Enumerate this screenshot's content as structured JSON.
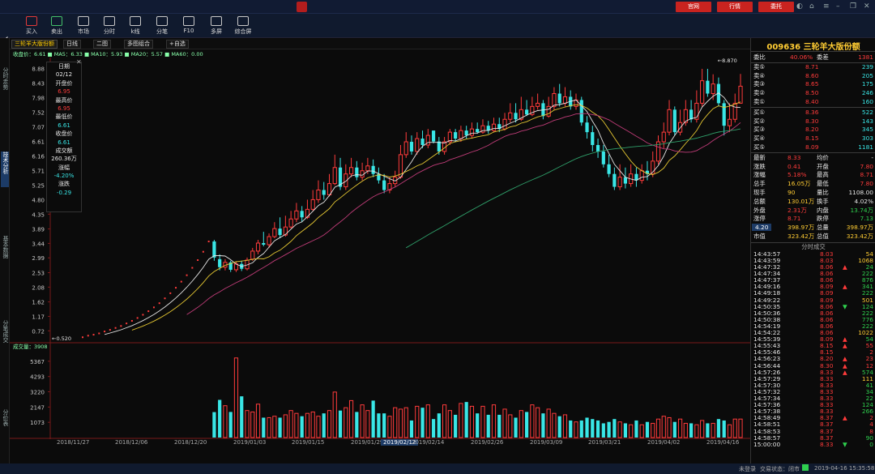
{
  "app": {
    "title": ""
  },
  "header_buttons": [
    "官网",
    "行情",
    "委托"
  ],
  "toolbar": [
    {
      "label": "买入",
      "icon": "buy-icon",
      "color": "red"
    },
    {
      "label": "卖出",
      "icon": "sell-icon",
      "color": "grn"
    },
    {
      "label": "市场",
      "icon": "market-icon",
      "color": ""
    },
    {
      "label": "分时",
      "icon": "timeshare-icon",
      "color": ""
    },
    {
      "label": "k线",
      "icon": "kline-icon",
      "color": ""
    },
    {
      "label": "分笔",
      "icon": "ticks-icon",
      "color": ""
    },
    {
      "label": "F10",
      "icon": "f10-icon",
      "color": ""
    },
    {
      "label": "多屏",
      "icon": "multiscreen-icon",
      "color": ""
    },
    {
      "label": "综合屏",
      "icon": "dashboard-icon",
      "color": ""
    }
  ],
  "left_tabs": [
    "分时走势",
    "技术分析",
    "基本数据",
    "分笔成交",
    "分价表"
  ],
  "chart_tabs": [
    "三轮羊大版份额",
    "日线",
    "二图",
    "多图组合",
    "+自选"
  ],
  "ma_legend": "收盘价：6.61  ■ MA5：6.33  ■ MA10：5.93  ■ MA20：5.57  ■ MA60：0.00",
  "vol_legend": "成交量：3908",
  "info": {
    "date_label": "日期",
    "date": "02/12",
    "open_label": "开盘价",
    "open": "6.95",
    "high_label": "最高价",
    "high": "6.95",
    "low_label": "最低价",
    "low": "6.61",
    "close_label": "收盘价",
    "close": "6.61",
    "amount_label": "成交额",
    "amount": "260.36万",
    "pct_label": "涨幅",
    "pct": "-4.20%",
    "chg_label": "涨跌",
    "chg": "-0.29"
  },
  "annotations": {
    "high": "←8.870",
    "low": "←0.520"
  },
  "right": {
    "code": "009636",
    "name": "三轮羊大版份额",
    "wei": {
      "l1": "委比",
      "v1": "40.06%",
      "l2": "委差",
      "v2": "1381"
    },
    "sells": [
      {
        "label": "卖⑤",
        "price": "8.71",
        "vol": "239"
      },
      {
        "label": "卖④",
        "price": "8.60",
        "vol": "205"
      },
      {
        "label": "卖③",
        "price": "8.65",
        "vol": "175"
      },
      {
        "label": "卖②",
        "price": "8.50",
        "vol": "246"
      },
      {
        "label": "卖①",
        "price": "8.40",
        "vol": "160"
      }
    ],
    "buys": [
      {
        "label": "买①",
        "price": "8.36",
        "vol": "522"
      },
      {
        "label": "买②",
        "price": "8.30",
        "vol": "143"
      },
      {
        "label": "买③",
        "price": "8.20",
        "vol": "345"
      },
      {
        "label": "买④",
        "price": "8.15",
        "vol": "303"
      },
      {
        "label": "买⑤",
        "price": "8.09",
        "vol": "1181"
      }
    ],
    "stats": [
      {
        "l1": "最新",
        "v1": "8.33",
        "c1": "red",
        "l2": "均价",
        "v2": "-",
        "c2": "wht"
      },
      {
        "l1": "涨跌",
        "v1": "0.41",
        "c1": "red",
        "l2": "开盘",
        "v2": "7.80",
        "c2": "red"
      },
      {
        "l1": "涨幅",
        "v1": "5.18%",
        "c1": "red",
        "l2": "最高",
        "v2": "8.71",
        "c2": "red"
      },
      {
        "l1": "总手",
        "v1": "16.05万",
        "c1": "yel",
        "l2": "最低",
        "v2": "7.80",
        "c2": "red"
      },
      {
        "l1": "现手",
        "v1": "90",
        "c1": "yel",
        "l2": "量比",
        "v2": "1108.00",
        "c2": "wht"
      },
      {
        "l1": "总额",
        "v1": "130.01万",
        "c1": "yel",
        "l2": "换手",
        "v2": "4.02%",
        "c2": "wht"
      },
      {
        "l1": "外盘",
        "v1": "2.31万",
        "c1": "red",
        "l2": "内盘",
        "v2": "13.74万",
        "c2": "grn"
      },
      {
        "l1": "涨停",
        "v1": "8.71",
        "c1": "red",
        "l2": "跌停",
        "v2": "7.13",
        "c2": "grn"
      },
      {
        "l1": "4.20",
        "v1": "398.97万",
        "c1": "yel",
        "l2": "总量",
        "v2": "398.97万",
        "c2": "yel"
      },
      {
        "l1": "市值",
        "v1": "323.42万",
        "c1": "yel",
        "l2": "总值",
        "v2": "323.42万",
        "c2": "yel"
      }
    ],
    "ticks_title": "分时成交",
    "ticks": [
      [
        "14:43:57",
        "8.03",
        "",
        "54",
        "yel"
      ],
      [
        "14:43:59",
        "8.03",
        "",
        "1068",
        "yel"
      ],
      [
        "14:47:32",
        "8.06",
        "▲",
        "24",
        "grn"
      ],
      [
        "14:47:34",
        "8.06",
        "",
        "222",
        "grn"
      ],
      [
        "14:47:37",
        "8.06",
        "",
        "876",
        "grn"
      ],
      [
        "14:49:16",
        "8.09",
        "▲",
        "341",
        "grn"
      ],
      [
        "14:49:18",
        "8.09",
        "",
        "222",
        "grn"
      ],
      [
        "14:49:22",
        "8.09",
        "",
        "501",
        "yel"
      ],
      [
        "14:50:35",
        "8.06",
        "▼",
        "124",
        "grn"
      ],
      [
        "14:50:36",
        "8.06",
        "",
        "222",
        "grn"
      ],
      [
        "14:50:38",
        "8.06",
        "",
        "776",
        "grn"
      ],
      [
        "14:54:19",
        "8.06",
        "",
        "222",
        "grn"
      ],
      [
        "14:54:22",
        "8.06",
        "",
        "1022",
        "yel"
      ],
      [
        "14:55:39",
        "8.09",
        "▲",
        "54",
        "grn"
      ],
      [
        "14:55:43",
        "8.15",
        "▲",
        "55",
        "red"
      ],
      [
        "14:55:46",
        "8.15",
        "",
        "2",
        "red"
      ],
      [
        "14:56:23",
        "8.20",
        "▲",
        "23",
        "red"
      ],
      [
        "14:56:44",
        "8.30",
        "▲",
        "12",
        "red"
      ],
      [
        "14:57:26",
        "8.33",
        "▲",
        "574",
        "grn"
      ],
      [
        "14:57:29",
        "8.33",
        "",
        "111",
        "yel"
      ],
      [
        "14:57:30",
        "8.33",
        "",
        "41",
        "grn"
      ],
      [
        "14:57:32",
        "8.33",
        "",
        "34",
        "grn"
      ],
      [
        "14:57:34",
        "8.33",
        "",
        "22",
        "grn"
      ],
      [
        "14:57:36",
        "8.33",
        "",
        "124",
        "grn"
      ],
      [
        "14:57:38",
        "8.33",
        "",
        "266",
        "grn"
      ],
      [
        "14:58:49",
        "8.37",
        "▲",
        "2",
        "red"
      ],
      [
        "14:58:51",
        "8.37",
        "",
        "4",
        "red"
      ],
      [
        "14:58:53",
        "8.37",
        "",
        "8",
        "red"
      ],
      [
        "14:58:57",
        "8.37",
        "",
        "90",
        "grn"
      ],
      [
        "15:00:00",
        "8.33",
        "▼",
        "0",
        "grn"
      ]
    ]
  },
  "status": {
    "text1": "未登录",
    "text2": "交易状态：闭市",
    "time": "2019-04-16 15:35:58"
  },
  "chart_data": {
    "type": "candlestick",
    "price_ticks": [
      "8.88",
      "8.43",
      "7.98",
      "7.52",
      "7.07",
      "6.61",
      "6.16",
      "5.71",
      "5.25",
      "4.80",
      "4.35",
      "3.89",
      "3.44",
      "2.99",
      "2.53",
      "2.08",
      "1.62",
      "1.17",
      "0.72"
    ],
    "price_range": [
      0.4,
      9.02
    ],
    "volume_ticks": [
      "5367",
      "4293",
      "3220",
      "2147",
      "1073"
    ],
    "volume_range": [
      0,
      6100
    ],
    "x_labels": [
      "2018/11/27",
      "2018/12/06",
      "2018/12/20",
      "2019/01/03",
      "2019/01/15",
      "2019/01/29",
      "2019/02/12",
      "2019/02/14",
      "2019/02/26",
      "2019/03/09",
      "2019/03/21",
      "2019/04/02",
      "2019/04/16"
    ],
    "highlight_label": "2019/02/12",
    "up_color": "#ff3b3b",
    "down_color": "#39e6e6",
    "ma_colors": {
      "ma5": "#e6e6e6",
      "ma10": "#e6c832",
      "ma20": "#c03c78",
      "ma60": "#2fa06a"
    },
    "candles": [
      [
        0.52,
        0.52,
        0.5,
        0.52,
        0
      ],
      [
        0.56,
        0.57,
        0.54,
        0.57,
        0
      ],
      [
        0.58,
        0.6,
        0.56,
        0.6,
        0
      ],
      [
        0.61,
        0.64,
        0.6,
        0.64,
        0
      ],
      [
        0.67,
        0.7,
        0.65,
        0.7,
        0
      ],
      [
        0.71,
        0.75,
        0.7,
        0.75,
        0
      ],
      [
        0.77,
        0.81,
        0.76,
        0.81,
        0
      ],
      [
        0.82,
        0.87,
        0.81,
        0.87,
        0
      ],
      [
        0.89,
        0.95,
        0.88,
        0.95,
        0
      ],
      [
        0.96,
        1.03,
        0.95,
        1.03,
        0
      ],
      [
        1.05,
        1.12,
        1.03,
        1.12,
        0
      ],
      [
        1.14,
        1.22,
        1.13,
        1.22,
        0
      ],
      [
        1.24,
        1.33,
        1.23,
        1.33,
        0
      ],
      [
        1.35,
        1.45,
        1.34,
        1.45,
        0
      ],
      [
        1.47,
        1.58,
        1.46,
        1.58,
        0
      ],
      [
        1.6,
        1.73,
        1.59,
        1.73,
        0
      ],
      [
        1.75,
        1.89,
        1.74,
        1.89,
        0
      ],
      [
        1.91,
        2.06,
        1.9,
        2.06,
        0
      ],
      [
        2.08,
        2.25,
        2.06,
        2.25,
        0
      ],
      [
        2.27,
        2.45,
        2.25,
        2.45,
        0
      ],
      [
        2.48,
        2.68,
        2.46,
        2.68,
        0
      ],
      [
        2.7,
        2.92,
        2.68,
        2.92,
        0
      ],
      [
        2.95,
        3.18,
        2.9,
        3.18,
        0
      ],
      [
        3.2,
        3.5,
        3.15,
        3.5,
        0
      ],
      [
        3.5,
        3.0,
        2.9,
        3.55,
        1790
      ],
      [
        2.95,
        2.7,
        2.6,
        3.1,
        2650
      ],
      [
        2.7,
        2.85,
        2.6,
        2.95,
        2240
      ],
      [
        2.85,
        2.62,
        2.55,
        2.9,
        1800
      ],
      [
        2.62,
        2.8,
        2.55,
        2.88,
        5600
      ],
      [
        2.8,
        2.65,
        2.58,
        2.9,
        2900
      ],
      [
        2.65,
        2.92,
        2.6,
        3.0,
        1900
      ],
      [
        2.95,
        3.2,
        2.9,
        3.3,
        1800
      ],
      [
        3.2,
        3.45,
        3.1,
        3.55,
        2350
      ],
      [
        3.45,
        3.4,
        3.35,
        3.8,
        1400
      ],
      [
        3.4,
        3.65,
        3.3,
        3.75,
        1400
      ],
      [
        3.65,
        3.9,
        3.6,
        4.1,
        1500
      ],
      [
        3.9,
        3.7,
        3.6,
        4.25,
        1400
      ],
      [
        3.7,
        3.95,
        3.65,
        4.3,
        1600
      ],
      [
        3.95,
        4.2,
        3.9,
        4.45,
        1900
      ],
      [
        4.2,
        4.45,
        4.1,
        4.7,
        1700
      ],
      [
        4.45,
        4.25,
        4.1,
        4.6,
        1500
      ],
      [
        4.25,
        4.5,
        4.2,
        4.8,
        1700
      ],
      [
        4.5,
        4.8,
        4.45,
        5.1,
        1800
      ],
      [
        4.8,
        5.1,
        4.7,
        5.4,
        1500
      ],
      [
        5.1,
        4.95,
        4.8,
        5.35,
        1700
      ],
      [
        4.95,
        5.3,
        4.9,
        5.6,
        1900
      ],
      [
        5.3,
        5.8,
        5.25,
        6.2,
        3200
      ],
      [
        5.8,
        5.2,
        5.1,
        6.1,
        1900
      ],
      [
        5.2,
        5.6,
        5.1,
        5.9,
        2100
      ],
      [
        5.6,
        5.8,
        5.5,
        6.1,
        2600
      ],
      [
        5.8,
        5.5,
        5.4,
        6.0,
        1800
      ],
      [
        5.5,
        5.7,
        5.4,
        5.95,
        2300
      ],
      [
        5.7,
        5.85,
        5.6,
        6.1,
        1900
      ],
      [
        5.85,
        5.6,
        5.5,
        6.05,
        2600
      ],
      [
        5.6,
        5.4,
        5.3,
        5.8,
        1700
      ],
      [
        5.4,
        5.1,
        5.0,
        5.6,
        1700
      ],
      [
        5.1,
        5.3,
        5.0,
        5.5,
        1500
      ],
      [
        5.3,
        5.5,
        5.2,
        5.7,
        2100
      ],
      [
        5.5,
        6.2,
        5.45,
        6.5,
        2000
      ],
      [
        6.2,
        6.6,
        6.1,
        6.9,
        2100
      ],
      [
        6.6,
        6.3,
        6.2,
        6.8,
        1200
      ],
      [
        6.3,
        6.7,
        6.2,
        6.9,
        2200
      ],
      [
        6.7,
        6.5,
        6.4,
        6.95,
        2100
      ],
      [
        6.5,
        6.8,
        6.4,
        7.0,
        2300
      ],
      [
        6.95,
        6.61,
        6.55,
        6.95,
        1300
      ],
      [
        6.61,
        6.3,
        6.2,
        6.75,
        1700
      ],
      [
        6.3,
        6.6,
        6.2,
        6.75,
        2300
      ],
      [
        6.6,
        6.9,
        6.5,
        7.0,
        1900
      ],
      [
        6.9,
        6.7,
        6.6,
        7.0,
        1600
      ],
      [
        6.7,
        6.95,
        6.6,
        7.1,
        2400
      ],
      [
        6.95,
        6.8,
        6.7,
        7.1,
        2500
      ],
      [
        6.8,
        7.0,
        6.7,
        7.2,
        2200
      ],
      [
        7.0,
        6.9,
        6.85,
        7.2,
        1700
      ],
      [
        6.9,
        7.1,
        6.85,
        7.3,
        2200
      ],
      [
        7.1,
        6.95,
        6.85,
        7.25,
        1600
      ],
      [
        6.95,
        7.15,
        6.9,
        7.35,
        2300
      ],
      [
        7.15,
        7.0,
        6.9,
        7.35,
        1600
      ],
      [
        7.0,
        7.3,
        6.95,
        7.5,
        2000
      ],
      [
        7.3,
        7.5,
        7.2,
        7.8,
        1600
      ],
      [
        7.5,
        7.3,
        7.2,
        7.8,
        1400
      ],
      [
        7.3,
        7.6,
        7.25,
        8.0,
        1900
      ],
      [
        7.6,
        7.45,
        7.4,
        7.9,
        1800
      ],
      [
        7.45,
        7.7,
        7.4,
        8.0,
        2300
      ],
      [
        7.7,
        7.8,
        7.6,
        8.1,
        2100
      ],
      [
        7.8,
        7.4,
        7.3,
        7.9,
        1700
      ],
      [
        7.4,
        7.7,
        7.35,
        8.0,
        2000
      ],
      [
        7.7,
        8.1,
        7.6,
        8.3,
        1700
      ],
      [
        8.1,
        7.8,
        7.7,
        8.4,
        1500
      ],
      [
        7.8,
        8.0,
        7.7,
        8.3,
        1600
      ],
      [
        8.0,
        7.7,
        7.6,
        8.2,
        1200
      ],
      [
        7.7,
        7.9,
        7.6,
        8.1,
        1100
      ],
      [
        7.9,
        7.2,
        7.1,
        8.0,
        1200
      ],
      [
        7.2,
        6.9,
        6.7,
        7.4,
        1400
      ],
      [
        6.9,
        6.5,
        6.3,
        7.1,
        1300
      ],
      [
        6.5,
        6.3,
        6.1,
        6.7,
        1200
      ],
      [
        6.3,
        5.9,
        5.8,
        6.5,
        1000
      ],
      [
        5.9,
        5.6,
        5.5,
        6.2,
        1100
      ],
      [
        5.6,
        5.2,
        5.1,
        5.8,
        1300
      ],
      [
        5.2,
        5.5,
        5.1,
        5.9,
        1100
      ],
      [
        5.5,
        5.3,
        5.15,
        5.8,
        1000
      ],
      [
        5.3,
        5.6,
        5.2,
        5.9,
        900
      ],
      [
        5.6,
        5.4,
        5.2,
        5.8,
        1200
      ],
      [
        5.4,
        5.7,
        5.3,
        5.9,
        900
      ],
      [
        5.7,
        5.6,
        5.4,
        6.0,
        1100
      ],
      [
        5.6,
        6.0,
        5.5,
        6.3,
        1000
      ],
      [
        6.0,
        6.6,
        5.9,
        6.8,
        1300
      ],
      [
        6.6,
        6.9,
        6.4,
        7.2,
        1500
      ],
      [
        6.9,
        7.6,
        6.8,
        7.9,
        1400
      ],
      [
        7.6,
        6.9,
        6.8,
        7.7,
        1100
      ],
      [
        6.9,
        7.2,
        6.8,
        7.6,
        1300
      ],
      [
        7.2,
        7.6,
        7.1,
        7.9,
        1000
      ],
      [
        7.6,
        7.3,
        7.2,
        7.9,
        1000
      ],
      [
        7.3,
        7.8,
        7.2,
        8.2,
        900
      ],
      [
        7.8,
        8.5,
        7.7,
        8.87,
        1200
      ],
      [
        8.5,
        8.1,
        8.0,
        8.87,
        1000
      ],
      [
        8.1,
        8.4,
        7.9,
        8.7,
        1000
      ],
      [
        8.4,
        7.8,
        7.7,
        8.6,
        1300
      ],
      [
        7.8,
        7.1,
        6.8,
        7.9,
        1200
      ],
      [
        7.1,
        7.3,
        6.9,
        7.8,
        900
      ],
      [
        7.3,
        7.8,
        7.2,
        8.1,
        1300
      ],
      [
        7.8,
        8.33,
        7.8,
        8.71,
        1300
      ]
    ]
  }
}
